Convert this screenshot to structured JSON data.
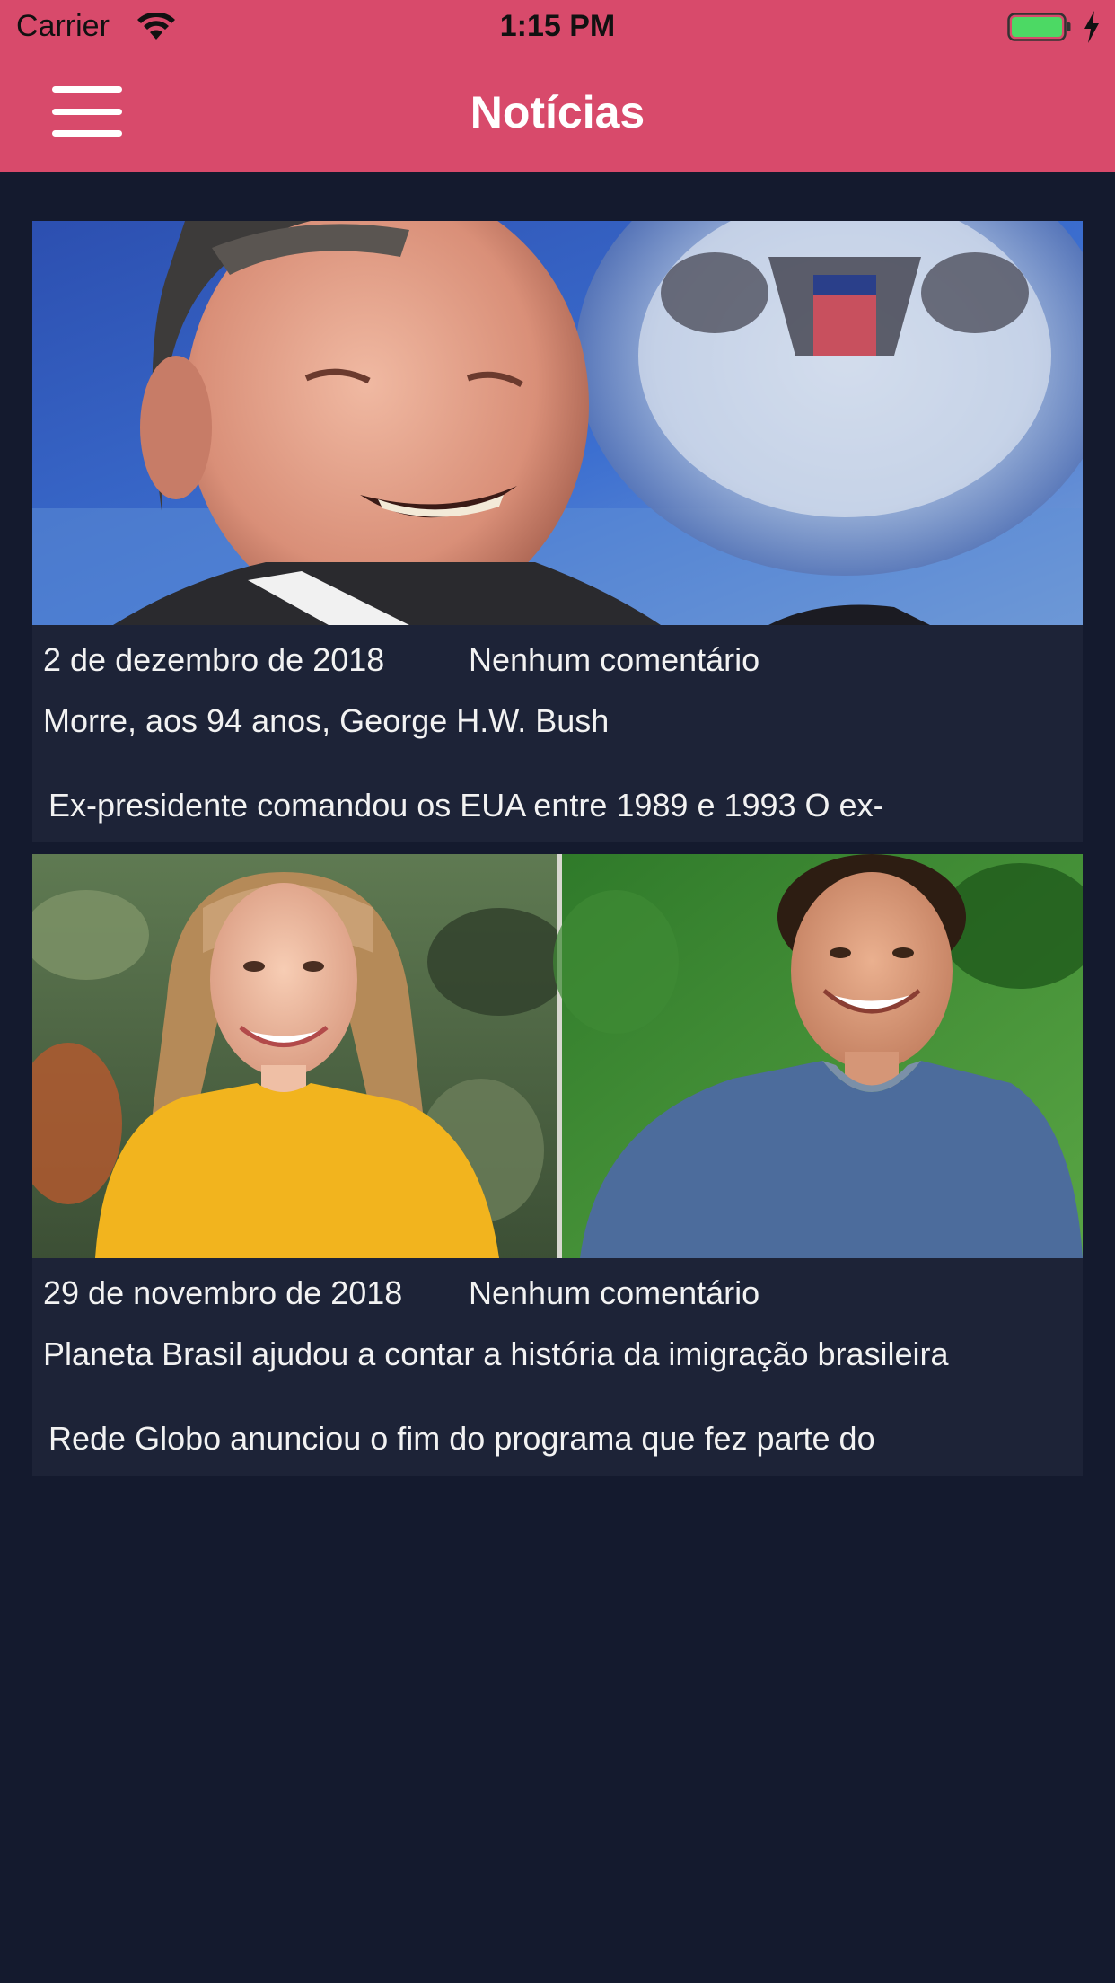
{
  "status_bar": {
    "carrier": "Carrier",
    "time": "1:15 PM",
    "icons": [
      "wifi-icon",
      "battery-icon",
      "charging-bolt-icon"
    ]
  },
  "nav": {
    "title": "Notícias",
    "menu_icon": "hamburger-menu-icon"
  },
  "colors": {
    "header": "#d84a6b",
    "background": "#141a2e",
    "card": "#1d2337",
    "text": "#f2f2f2",
    "battery_fill": "#4cd964"
  },
  "articles": [
    {
      "date": "2 de dezembro de 2018",
      "comments": "Nenhum comentário",
      "title": "Morre, aos 94 anos, George H.W. Bush",
      "excerpt": "Ex-presidente comandou os EUA entre 1989 e 1993 O ex-"
    },
    {
      "date": "29 de novembro de 2018",
      "comments": "Nenhum comentário",
      "title": "Planeta Brasil ajudou a contar a história da imigração brasileira",
      "excerpt": "Rede Globo anunciou o fim do programa que fez parte do"
    }
  ]
}
